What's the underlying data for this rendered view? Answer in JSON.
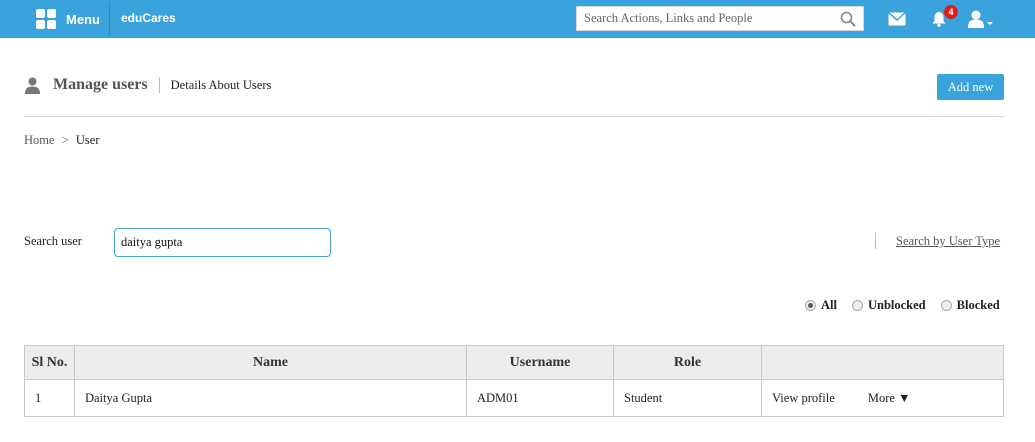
{
  "header": {
    "menu_label": "Menu",
    "brand": "eduCares",
    "search_placeholder": "Search Actions, Links and People",
    "notification_count": "4",
    "accent_color": "#3aa3dc",
    "icons": [
      "grid-icon",
      "search-icon",
      "mail-icon",
      "bell-icon",
      "user-icon"
    ]
  },
  "page": {
    "title": "Manage users",
    "subtitle": "Details About Users",
    "add_button": "Add new",
    "breadcrumb": {
      "home": "Home",
      "separator": ">",
      "current": "User"
    }
  },
  "search": {
    "label": "Search user",
    "value": "daitya gupta",
    "by_type_link": "Search by User Type"
  },
  "filters": {
    "selected": "All",
    "options": [
      "All",
      "Unblocked",
      "Blocked"
    ]
  },
  "table": {
    "headers": [
      "Sl No.",
      "Name",
      "Username",
      "Role",
      ""
    ],
    "rows": [
      {
        "sl": "1",
        "name": "Daitya Gupta",
        "username": "ADM01",
        "role": "Student",
        "view": "View profile",
        "more": "More ▼"
      }
    ]
  }
}
